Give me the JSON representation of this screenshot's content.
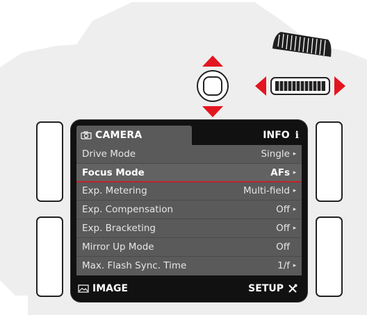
{
  "header": {
    "camera_tab": "CAMERA",
    "info_tab": "INFO",
    "info_icon_glyph": "i"
  },
  "menu": {
    "items": [
      {
        "label": "Drive Mode",
        "value": "Single"
      },
      {
        "label": "Focus Mode",
        "value": "AFs"
      },
      {
        "label": "Exp. Metering",
        "value": "Multi-field"
      },
      {
        "label": "Exp. Compensation",
        "value": "Off"
      },
      {
        "label": "Exp. Bracketing",
        "value": "Off"
      },
      {
        "label": "Mirror Up Mode",
        "value": "Off"
      },
      {
        "label": "Max. Flash Sync. Time",
        "value": "1/f"
      }
    ]
  },
  "footer": {
    "image_tab": "IMAGE",
    "setup_tab": "SETUP"
  },
  "icons": {
    "camera": "camera-icon",
    "info": "info-icon",
    "image": "image-icon",
    "setup": "tools-icon",
    "submenu": "chevron-right-icon"
  },
  "colors": {
    "accent_red": "#e3161f",
    "screen_bg": "#111111",
    "menu_bg": "#5a5a5a",
    "selection_line": "#c0232b",
    "body_gray": "#eeeeee"
  }
}
